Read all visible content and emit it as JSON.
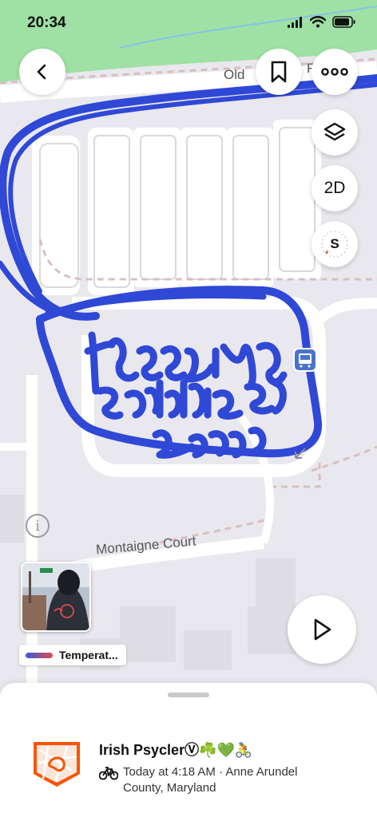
{
  "status_bar": {
    "time": "20:34"
  },
  "map": {
    "road_labels": {
      "old_road": "Old",
      "old_road_suffix": "F",
      "montaigne": "Montaigne Court"
    },
    "handwriting": "freezing saddles 2026"
  },
  "controls": {
    "back": "back",
    "bookmark": "bookmark",
    "more": "more",
    "layers": "layers",
    "view_mode": "2D",
    "compass_letter": "S",
    "play": "play",
    "info": "info"
  },
  "legend": {
    "label": "Temperat..."
  },
  "activity": {
    "athlete": "Irish PsyclerⓋ☘️💚🚴",
    "meta": "Today at 4:18 AM · Anne Arundel County, Maryland"
  },
  "colors": {
    "route": "#2f48d6",
    "map_bg": "#e9e8ee",
    "park": "#9fe0a4",
    "accent": "#fc5200"
  }
}
